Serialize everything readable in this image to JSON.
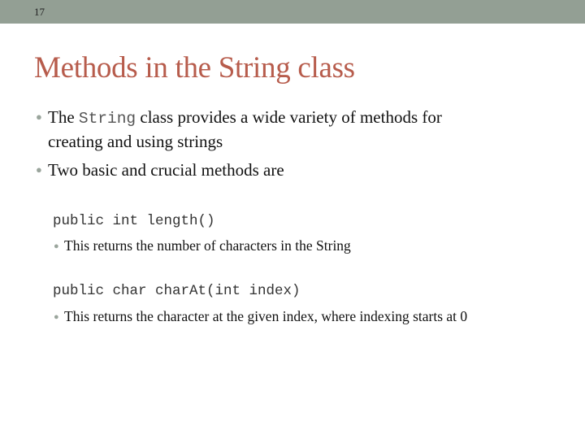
{
  "slide": {
    "number": "17",
    "title": "Methods in the String class",
    "bullets": [
      {
        "pre": "The ",
        "code": "String",
        "post": " class provides a wide variety of methods for",
        "continuation": "creating and using strings"
      },
      {
        "text": "Two basic and crucial methods are"
      }
    ],
    "methods": [
      {
        "signature": "public int length()",
        "description": "This returns the number of characters in the String"
      },
      {
        "signature": "public char charAt(int index)",
        "description": "This returns the character at the given index, where indexing starts at 0"
      }
    ],
    "colors": {
      "header_bar": "#939f94",
      "title": "#b75c4c",
      "bullet": "#9aa59c"
    }
  }
}
